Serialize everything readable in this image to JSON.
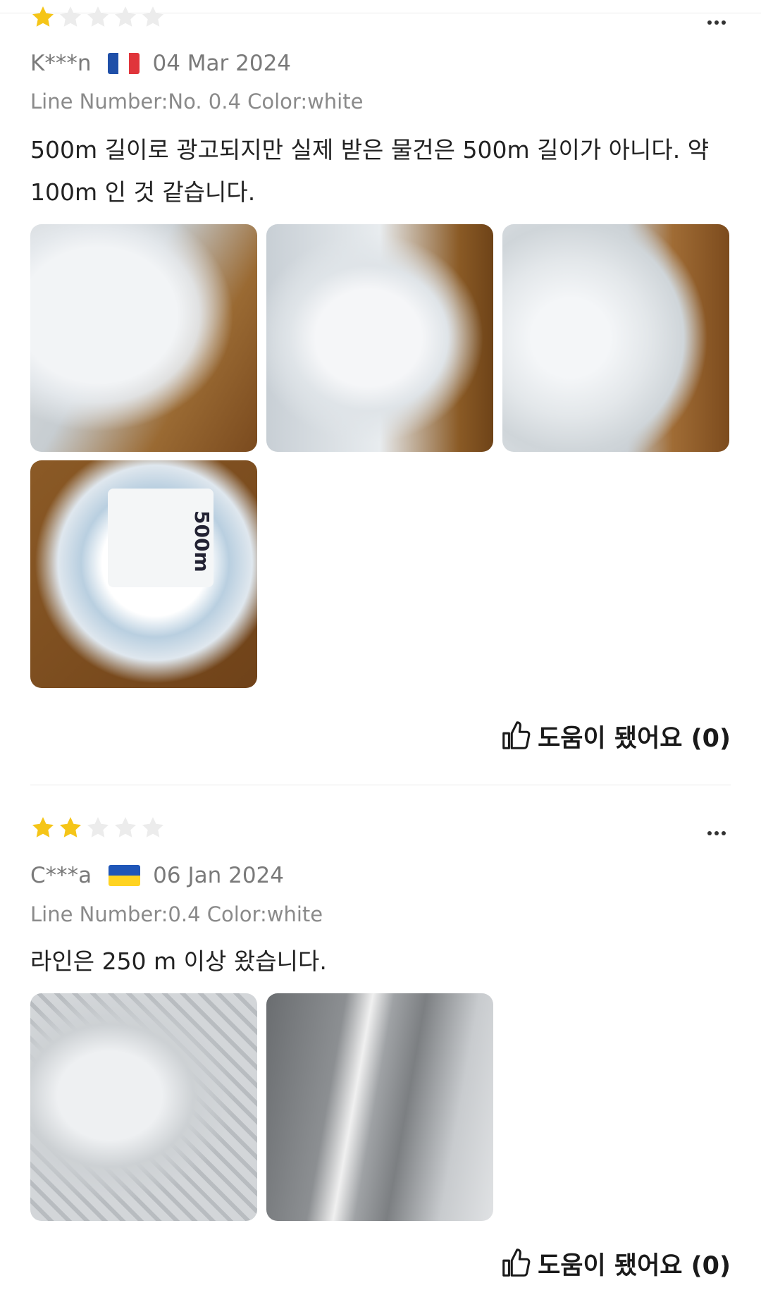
{
  "reviews": [
    {
      "rating": 1,
      "author": "K***n",
      "country_flag": "france-flag",
      "date": "04 Mar 2024",
      "sku": "Line Number:No. 0.4 Color:white",
      "text": "500m 길이로 광고되지만 실제 받은 물건은 500m 길이가 아니다. 약 100m 인 것 같습니다.",
      "photo_label_text": "500m",
      "helpful_label": "도움이 됐어요 (0)"
    },
    {
      "rating": 2,
      "author": "C***a",
      "country_flag": "ukraine-flag",
      "date": "06 Jan 2024",
      "sku": "Line Number:0.4 Color:white",
      "text": "라인은 250 m 이상 왔습니다.",
      "helpful_label": "도움이 됐어요 (0)"
    }
  ],
  "colors": {
    "star_filled": "#f5c518",
    "star_empty": "#e6e6e6",
    "text_primary": "#222222",
    "text_secondary": "#7a7a7a"
  }
}
